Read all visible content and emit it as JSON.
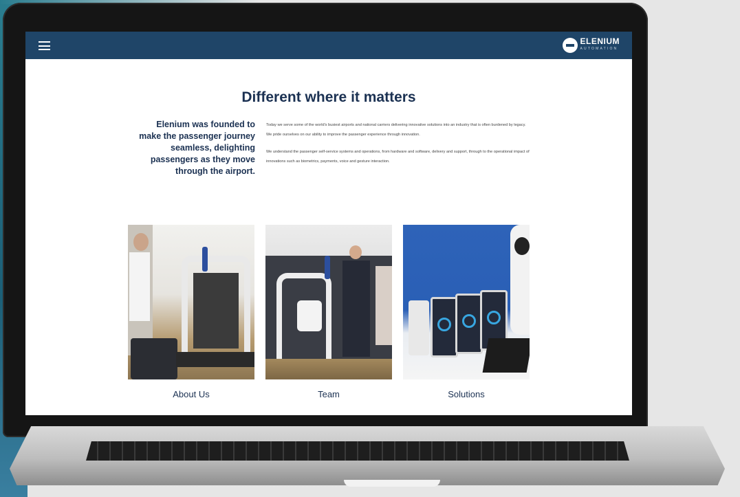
{
  "site": {
    "logo_text": "ELENIUM",
    "logo_sub": "AUTOMATION"
  },
  "main": {
    "heading": "Different where it matters",
    "lead": "Elenium was founded to make the passenger journey seamless, delighting passengers as they move through the airport.",
    "paragraphs": [
      "Today we serve some of the world's busiest airports and national carriers delivering innovative solutions into an industry that is often burdened by legacy. We pride ourselves on our ability to improve the passenger experience through innovation.",
      "We understand the passenger self-service systems and operations, from hardware and software, delivery and support, through to the operational impact of innovations such as biometrics, payments, voice and gesture interaction."
    ]
  },
  "cards": [
    {
      "label": "About Us"
    },
    {
      "label": "Team"
    },
    {
      "label": "Solutions"
    }
  ],
  "icons": {
    "menu": "hamburger-icon",
    "logo": "elenium-logo-mark"
  },
  "colors": {
    "nav": "#1f4568",
    "heading": "#1b3152"
  }
}
